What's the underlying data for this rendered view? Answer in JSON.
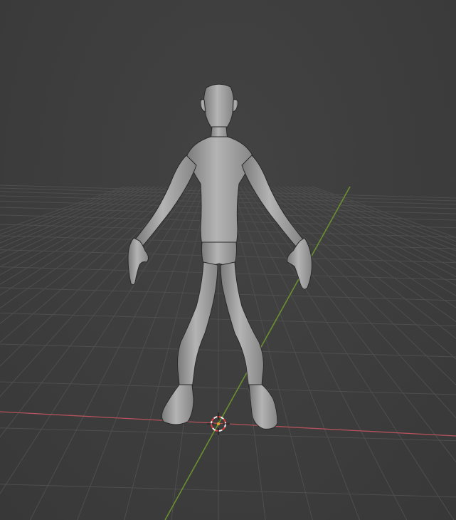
{
  "app": {
    "name": "3D Viewport",
    "background_color": "#3d3d3d"
  },
  "scene": {
    "grid_color": "#4e4e4e",
    "x_axis_color": "#b5525c",
    "y_axis_color": "#6b8f2f",
    "object": {
      "type": "mesh",
      "icon": "humanoid-mesh",
      "display": "solid-wireframe",
      "fill_color": "#9e9e9e",
      "wire_color": "#1c1c1c"
    },
    "cursor": {
      "icon": "3d-cursor-icon",
      "primary_color": "#e53b3b",
      "secondary_color": "#f2f2f2"
    }
  }
}
